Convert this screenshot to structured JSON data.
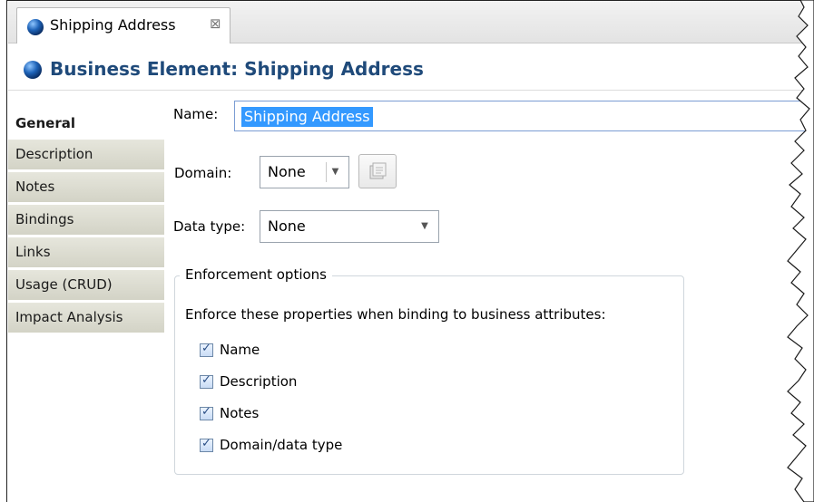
{
  "tab": {
    "title": "Shipping Address",
    "close_glyph": "⊠",
    "icon": "globe-icon"
  },
  "header": {
    "title": "Business Element: Shipping Address",
    "icon": "globe-icon"
  },
  "nav": {
    "items": [
      {
        "label": "General",
        "active": true
      },
      {
        "label": "Description",
        "active": false
      },
      {
        "label": "Notes",
        "active": false
      },
      {
        "label": "Bindings",
        "active": false
      },
      {
        "label": "Links",
        "active": false
      },
      {
        "label": "Usage (CRUD)",
        "active": false
      },
      {
        "label": "Impact Analysis",
        "active": false
      }
    ]
  },
  "form": {
    "name_label": "Name:",
    "name_value": "Shipping Address",
    "domain_label": "Domain:",
    "domain_value": "None",
    "domain_button_icon": "properties-icon",
    "datatype_label": "Data type:",
    "datatype_value": "None"
  },
  "enforcement": {
    "title": "Enforcement options",
    "description": "Enforce these properties when binding to business attributes:",
    "options": [
      {
        "label": "Name",
        "checked": true
      },
      {
        "label": "Description",
        "checked": true
      },
      {
        "label": "Notes",
        "checked": true
      },
      {
        "label": "Domain/data type",
        "checked": true
      }
    ]
  },
  "colors": {
    "header_title": "#1f4a7a",
    "selection": "#3399ff",
    "nav_bg": "#d8d8cb"
  }
}
